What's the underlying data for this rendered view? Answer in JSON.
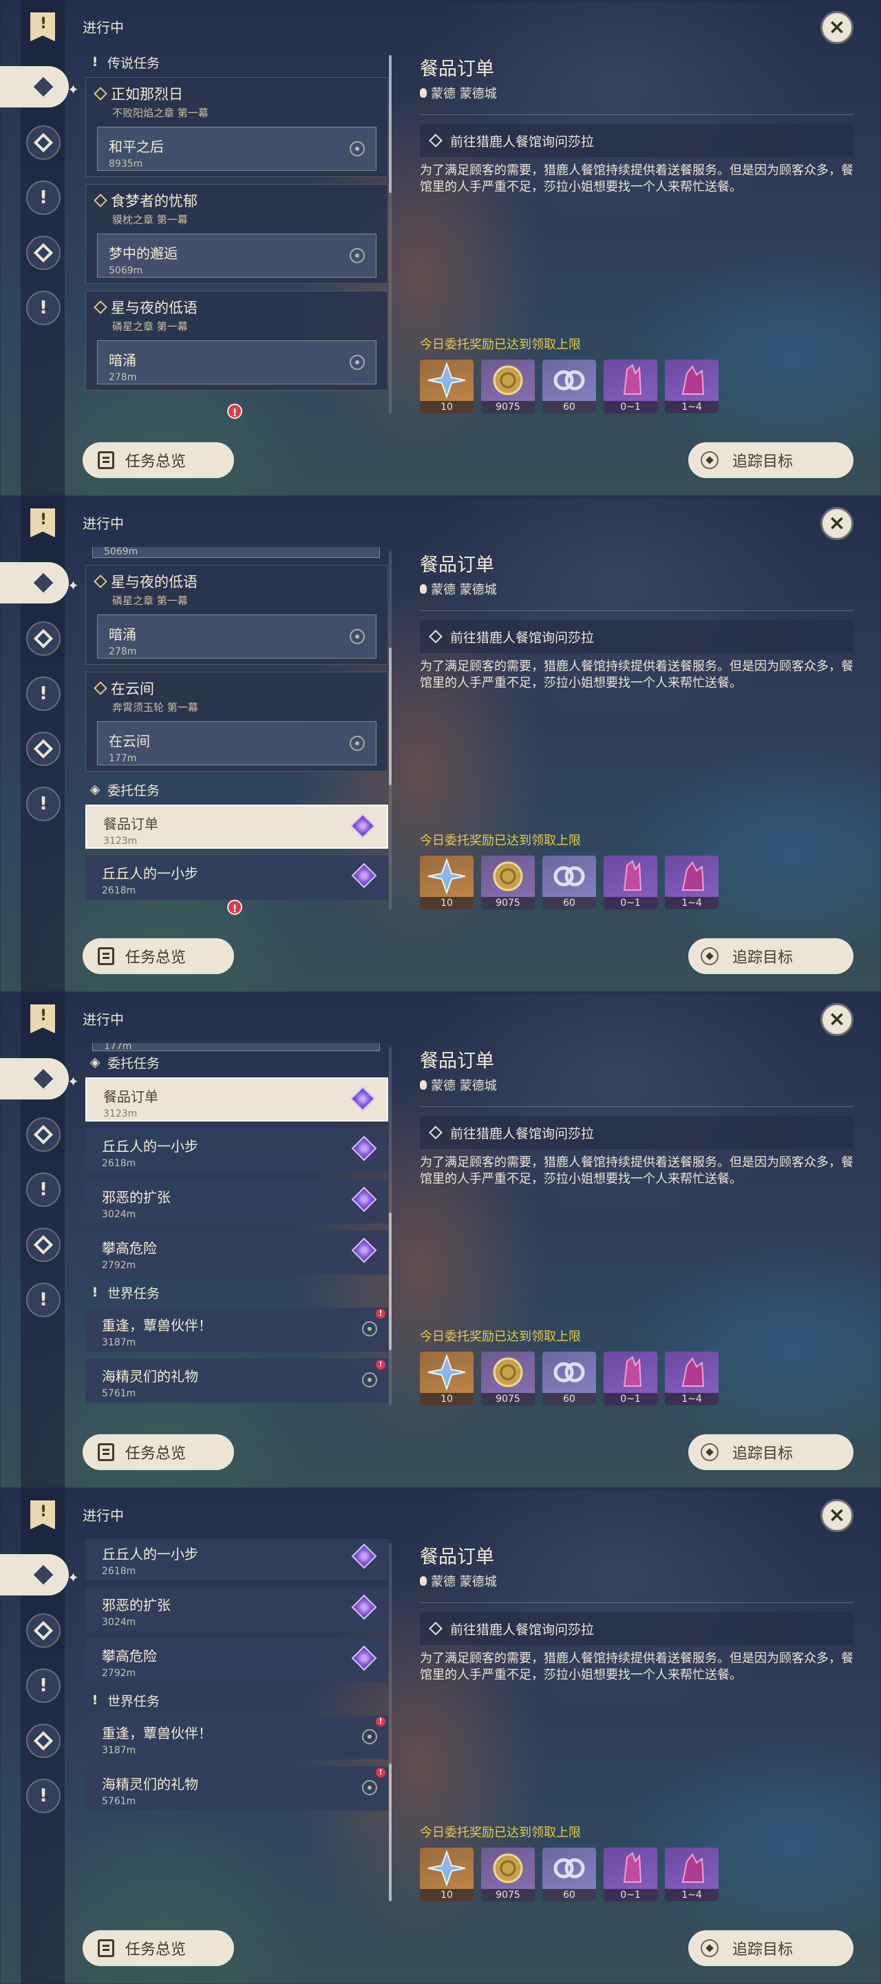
{
  "header": {
    "ongoing_label": "进行中"
  },
  "buttons": {
    "overview": "任务总览",
    "track": "追踪目标",
    "close_glyph": "×"
  },
  "detail": {
    "title": "餐品订单",
    "location": "蒙德 蒙德城",
    "objective": "前往猎鹿人餐馆询问莎拉",
    "description": "为了满足顾客的需要，猎鹿人餐馆持续提供着送餐服务。但是因为顾客众多，餐馆里的人手严重不足，莎拉小姐想要找一个人来帮忙送餐。",
    "reward_limit": "今日委托奖励已达到领取上限",
    "rewards": [
      {
        "icon": "primogem-icon",
        "count": "10"
      },
      {
        "icon": "mora-icon",
        "count": "9075"
      },
      {
        "icon": "adventure-exp-icon",
        "count": "60"
      },
      {
        "icon": "ore-crystal-icon",
        "count": "0~1"
      },
      {
        "icon": "ore-chunk-icon",
        "count": "1~4"
      }
    ]
  },
  "sections": {
    "legend": "传说任务",
    "commission": "委托任务",
    "world": "世界任务"
  },
  "legend_groups": [
    {
      "title": "正如那烈日",
      "chapter": "不败阳焰之章 第一幕",
      "items": [
        {
          "name": "和平之后",
          "distance": "8935m"
        }
      ]
    },
    {
      "title": "食梦者的忧郁",
      "chapter": "貘枕之章 第一幕",
      "items": [
        {
          "name": "梦中的邂逅",
          "distance": "5069m"
        }
      ]
    },
    {
      "title": "星与夜的低语",
      "chapter": "磷星之章 第一幕",
      "items": [
        {
          "name": "暗涌",
          "distance": "278m"
        }
      ]
    },
    {
      "title": "在云间",
      "chapter": "奔霄须玉轮 第一幕",
      "items": [
        {
          "name": "在云间",
          "distance": "177m"
        }
      ]
    }
  ],
  "commissions": [
    {
      "name": "餐品订单",
      "distance": "3123m"
    },
    {
      "name": "丘丘人的一小步",
      "distance": "2618m"
    },
    {
      "name": "邪恶的扩张",
      "distance": "3024m"
    },
    {
      "name": "攀高危险",
      "distance": "2792m"
    }
  ],
  "world_quests": [
    {
      "name": "重逢，蕈兽伙伴！",
      "distance": "3187m"
    },
    {
      "name": "海精灵们的礼物",
      "distance": "5761m"
    }
  ],
  "partial_top": {
    "s2": "5069m",
    "s3": "177m"
  },
  "colors": {
    "accent_cream": "#ece5d6",
    "limit_yellow": "#e8c84a",
    "alert_red": "#e1384d",
    "commission_purple": "#8a5ad6"
  }
}
